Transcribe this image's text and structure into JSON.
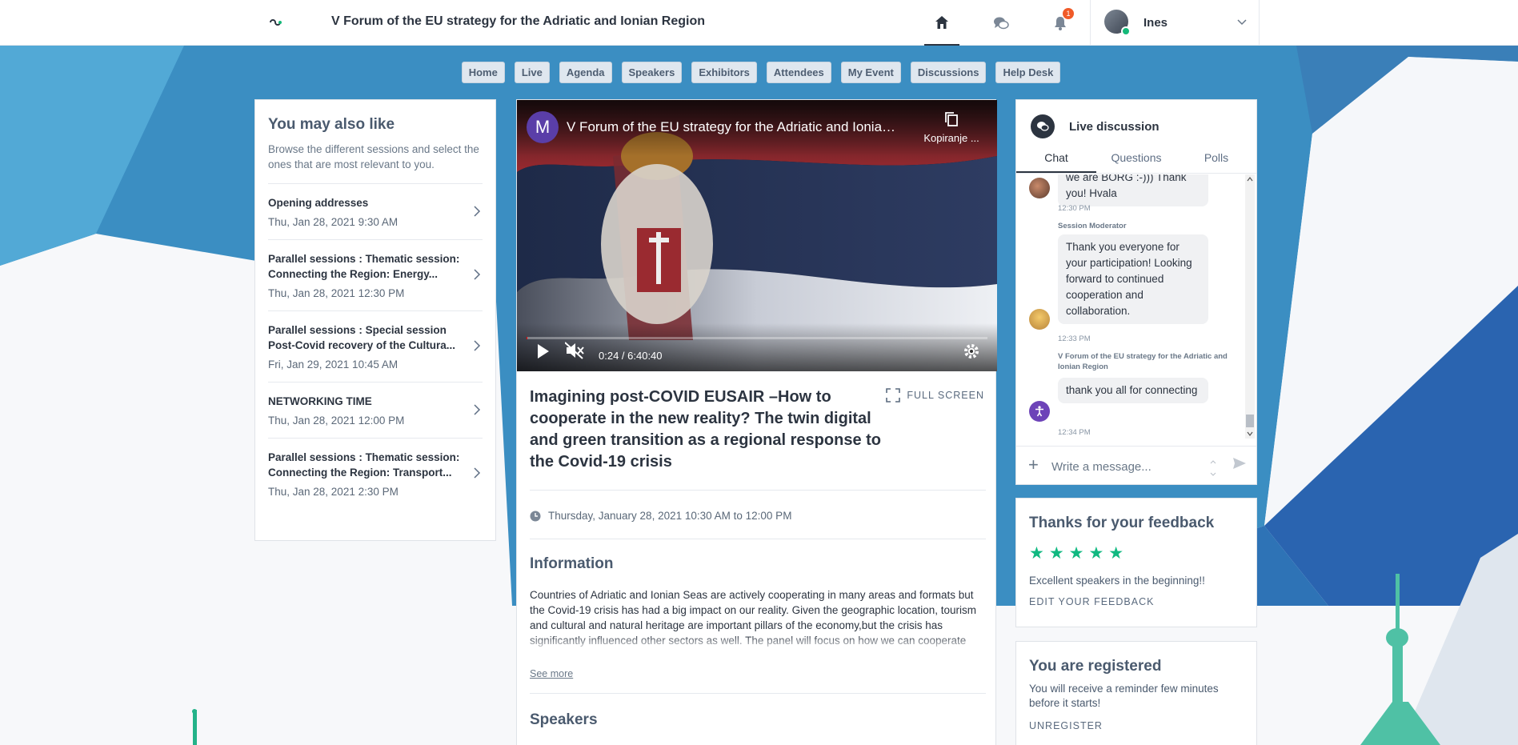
{
  "header": {
    "event_title": "V Forum of the EU strategy for the Adriatic and Ionian Region",
    "notification_count": "1",
    "user_name": "Ines"
  },
  "nav": {
    "items": [
      "Home",
      "Live",
      "Agenda",
      "Speakers",
      "Exhibitors",
      "Attendees",
      "My Event",
      "Discussions",
      "Help Desk"
    ]
  },
  "recommendations": {
    "title": "You may also like",
    "subtitle": "Browse the different sessions and select the ones that are most relevant to you.",
    "sessions": [
      {
        "title": "Opening addresses",
        "date": "Thu, Jan 28, 2021 9:30 AM"
      },
      {
        "title": "Parallel sessions : Thematic session: Connecting the Region: Energy...",
        "date": "Thu, Jan 28, 2021 12:30 PM"
      },
      {
        "title": "Parallel sessions : Special session Post-Covid recovery of the Cultura...",
        "date": "Fri, Jan 29, 2021 10:45 AM"
      },
      {
        "title": "NETWORKING TIME",
        "date": "Thu, Jan 28, 2021 12:00 PM"
      },
      {
        "title": "Parallel sessions : Thematic session: Connecting the Region: Transport...",
        "date": "Thu, Jan 28, 2021 2:30 PM"
      }
    ]
  },
  "video": {
    "channel_initial": "M",
    "title": "V Forum of the EU strategy for the Adriatic and Ionian Region",
    "copy_label": "Kopiranje ...",
    "time": "0:24 / 6:40:40",
    "progress_fraction": 0.001
  },
  "session": {
    "title": "Imagining post-COVID EUSAIR –How to cooperate in the new reality? The twin digital and green transition as a regional response to the Covid-19 crisis",
    "fullscreen_label": "FULL SCREEN",
    "datetime": "Thursday, January 28, 2021 10:30 AM to 12:00 PM",
    "info_title": "Information",
    "info_text": "Countries of Adriatic and Ionian Seas are actively cooperating in many areas and formats but the Covid-19 crisis has had a big impact on our reality. Given the geographic location, tourism and cultural and natural heritage are important pillars of the economy,but the crisis has significantly influenced other sectors as well. The panel will focus on how we can cooperate effectively in the post-pandemic reality. Panellists  from",
    "see_more": "See more",
    "speakers_title": "Speakers"
  },
  "chat": {
    "title": "Live discussion",
    "tabs": [
      "Chat",
      "Questions",
      "Polls"
    ],
    "messages": [
      {
        "author": "",
        "text": "we are BORG :-))) Thank you! Hvala",
        "time": "12:30 PM"
      },
      {
        "author": "Session Moderator",
        "text": "Thank you everyone for your participation! Looking forward to continued cooperation and collaboration.",
        "time": "12:33 PM"
      },
      {
        "author": "V Forum of the EU strategy for the Adriatic and Ionian Region",
        "text": "thank you all for connecting",
        "time": "12:34 PM"
      }
    ],
    "input_placeholder": "Write a message..."
  },
  "feedback": {
    "title": "Thanks for your feedback",
    "rating": 5,
    "stars": "★★★★★",
    "comment": "Excellent speakers in the beginning!!",
    "edit_label": "EDIT YOUR FEEDBACK"
  },
  "registration": {
    "title": "You are registered",
    "text": "You will receive a reminder few minutes before it starts!",
    "unregister_label": "UNREGISTER"
  },
  "colors": {
    "accent": "#2c3440",
    "star": "#10b981",
    "badge": "#f05a28",
    "bg_blue": "#3b8fc0",
    "bg_teal": "#4fc1a5"
  }
}
